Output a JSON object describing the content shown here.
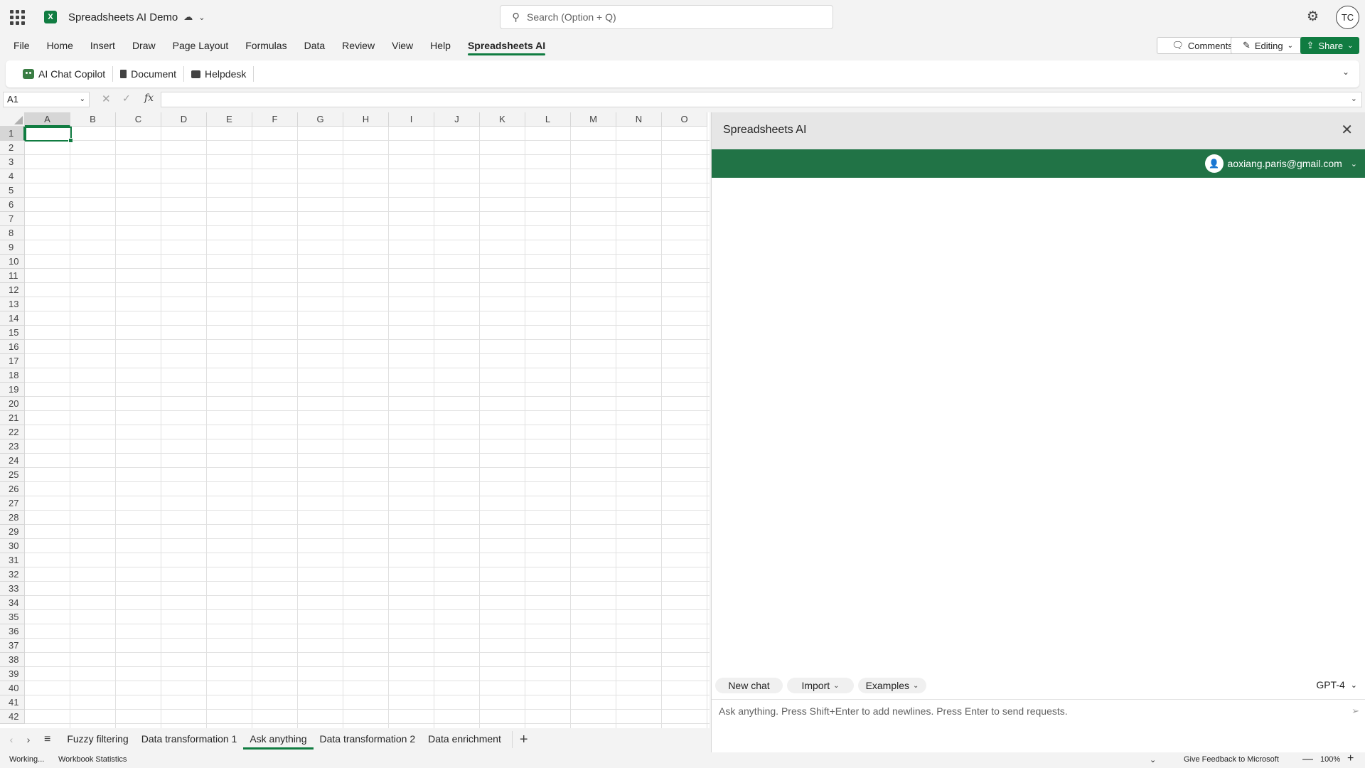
{
  "titlebar": {
    "app_icon": "excel-icon",
    "doc_title": "Spreadsheets AI Demo",
    "search_placeholder": "Search (Option + Q)",
    "avatar_initials": "TC"
  },
  "menu": {
    "tabs": [
      "File",
      "Home",
      "Insert",
      "Draw",
      "Page Layout",
      "Formulas",
      "Data",
      "Review",
      "View",
      "Help",
      "Spreadsheets AI"
    ],
    "active_tab": "Spreadsheets AI",
    "comments_label": "Comments",
    "editing_label": "Editing",
    "share_label": "Share"
  },
  "ribbon": {
    "copilot_label": "AI Chat Copilot",
    "document_label": "Document",
    "helpdesk_label": "Helpdesk"
  },
  "formula_bar": {
    "name_box": "A1",
    "fx_label": "fx",
    "formula": ""
  },
  "grid": {
    "columns": [
      "A",
      "B",
      "C",
      "D",
      "E",
      "F",
      "G",
      "H",
      "I",
      "J",
      "K",
      "L",
      "M",
      "N",
      "O"
    ],
    "rows": [
      "1",
      "2",
      "3",
      "4",
      "5",
      "6",
      "7",
      "8",
      "9",
      "10",
      "11",
      "12",
      "13",
      "14",
      "15",
      "16",
      "17",
      "18",
      "19",
      "20",
      "21",
      "22",
      "23",
      "24",
      "25",
      "26",
      "27",
      "28",
      "29",
      "30",
      "31",
      "32",
      "33",
      "34",
      "35",
      "36",
      "37",
      "38",
      "39",
      "40",
      "41",
      "42"
    ],
    "selected_cell": "A1"
  },
  "sheets": {
    "tabs": [
      "Fuzzy filtering",
      "Data transformation 1",
      "Ask anything",
      "Data transformation 2",
      "Data enrichment"
    ],
    "active": "Ask anything"
  },
  "status": {
    "working": "Working...",
    "stats": "Workbook Statistics",
    "feedback": "Give Feedback to Microsoft",
    "zoom": "100%"
  },
  "panel": {
    "title": "Spreadsheets AI",
    "user_email": "aoxiang.paris@gmail.com",
    "new_chat": "New chat",
    "import": "Import",
    "examples": "Examples",
    "model": "GPT-4",
    "input_placeholder": "Ask anything. Press Shift+Enter to add newlines. Press Enter to send requests.",
    "header_color": "#217346"
  },
  "colors": {
    "accent": "#107c41",
    "panel_green": "#217346"
  }
}
